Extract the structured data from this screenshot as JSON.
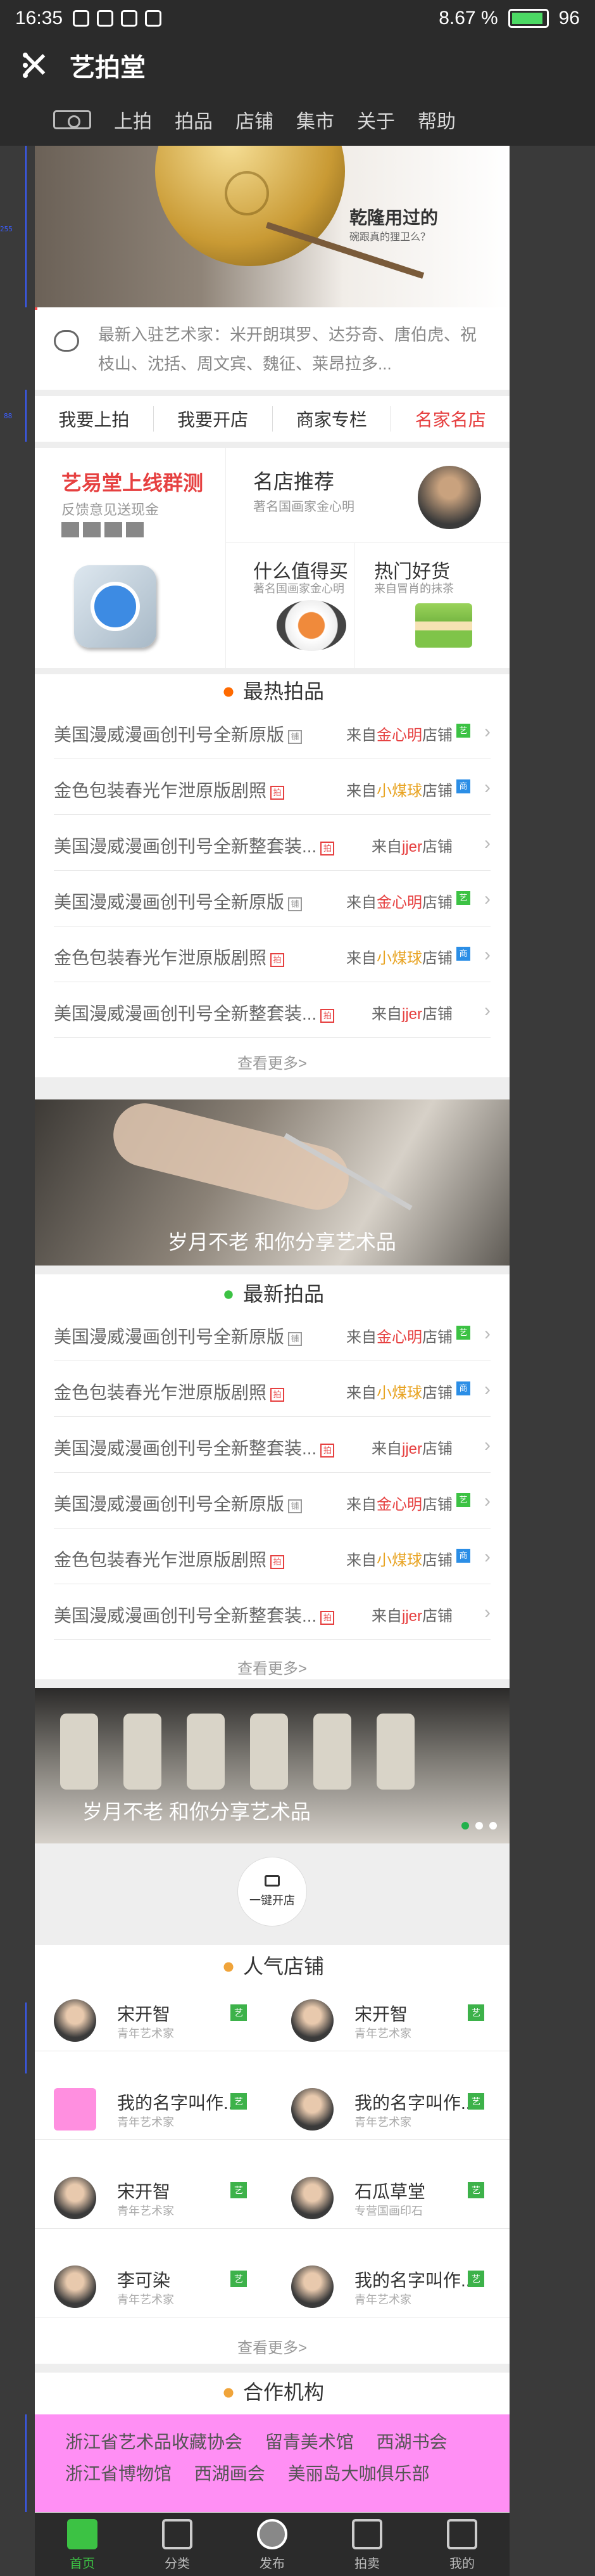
{
  "status_bar": {
    "time": "16:35",
    "battery_text": "8.67 %",
    "battery_level": "96"
  },
  "app_bar": {
    "close_glyph": "✕",
    "title": "艺拍堂"
  },
  "nav": {
    "items": [
      "上拍",
      "拍品",
      "店铺",
      "集市",
      "关于",
      "帮助"
    ]
  },
  "banner1": {
    "title": "乾隆用过的",
    "subtitle": "碗跟真的狸卫么？"
  },
  "notice": {
    "text": "最新入驻艺术家：米开朗琪罗、达芬奇、唐伯虎、祝枝山、沈括、周文宾、魏征、莱昂拉多..."
  },
  "quick_tabs": [
    "我要上拍",
    "我要开店",
    "商家专栏",
    "名家名店"
  ],
  "promo": {
    "left": {
      "title": "艺易堂上线群测",
      "subtitle": "反馈意见送现金"
    },
    "famous": {
      "title": "名店推荐",
      "subtitle": "著名国画家金心明"
    },
    "worth": {
      "title": "什么值得买",
      "subtitle": "著名国画家金心明"
    },
    "hot": {
      "title": "热门好货",
      "subtitle": "来自冒肖的抹茶"
    }
  },
  "hot_section": {
    "title": "最热拍品",
    "rows": [
      {
        "title": "美国漫威漫画创刊号全新原版",
        "tag": "铺",
        "shop_prefix": "来自",
        "shop_name": "金心明",
        "shop_suffix": "店铺",
        "badge": "艺"
      },
      {
        "title": "金色包装春光乍泄原版剧照",
        "tag": "拍",
        "shop_prefix": "来自",
        "shop_name": "小煤球",
        "shop_suffix": "店铺",
        "badge": "商"
      },
      {
        "title": "美国漫威漫画创刊号全新整套装...",
        "tag": "拍",
        "shop_prefix": "来自",
        "shop_name": "jjer",
        "shop_suffix": "店铺",
        "badge": ""
      },
      {
        "title": "美国漫威漫画创刊号全新原版",
        "tag": "铺",
        "shop_prefix": "来自",
        "shop_name": "金心明",
        "shop_suffix": "店铺",
        "badge": "艺"
      },
      {
        "title": "金色包装春光乍泄原版剧照",
        "tag": "拍",
        "shop_prefix": "来自",
        "shop_name": "小煤球",
        "shop_suffix": "店铺",
        "badge": "商"
      },
      {
        "title": "美国漫威漫画创刊号全新整套装...",
        "tag": "拍",
        "shop_prefix": "来自",
        "shop_name": "jjer",
        "shop_suffix": "店铺",
        "badge": ""
      }
    ],
    "more": "查看更多>"
  },
  "banner2": {
    "caption": "岁月不老 和你分享艺术品"
  },
  "new_section": {
    "title": "最新拍品",
    "rows": [
      {
        "title": "美国漫威漫画创刊号全新原版",
        "tag": "铺",
        "shop_prefix": "来自",
        "shop_name": "金心明",
        "shop_suffix": "店铺",
        "badge": "艺"
      },
      {
        "title": "金色包装春光乍泄原版剧照",
        "tag": "拍",
        "shop_prefix": "来自",
        "shop_name": "小煤球",
        "shop_suffix": "店铺",
        "badge": "商"
      },
      {
        "title": "美国漫威漫画创刊号全新整套装...",
        "tag": "拍",
        "shop_prefix": "来自",
        "shop_name": "jjer",
        "shop_suffix": "店铺",
        "badge": ""
      },
      {
        "title": "美国漫威漫画创刊号全新原版",
        "tag": "铺",
        "shop_prefix": "来自",
        "shop_name": "金心明",
        "shop_suffix": "店铺",
        "badge": "艺"
      },
      {
        "title": "金色包装春光乍泄原版剧照",
        "tag": "拍",
        "shop_prefix": "来自",
        "shop_name": "小煤球",
        "shop_suffix": "店铺",
        "badge": "商"
      },
      {
        "title": "美国漫威漫画创刊号全新整套装...",
        "tag": "拍",
        "shop_prefix": "来自",
        "shop_name": "jjer",
        "shop_suffix": "店铺",
        "badge": ""
      }
    ],
    "more": "查看更多>"
  },
  "banner3": {
    "caption": "岁月不老 和你分享艺术品"
  },
  "open_shop": {
    "label": "一键开店"
  },
  "popular_shops": {
    "title": "人气店铺",
    "shops": [
      {
        "name": "宋开智",
        "desc": "青年艺术家",
        "badge": "艺"
      },
      {
        "name": "宋开智",
        "desc": "青年艺术家",
        "badge": "艺"
      },
      {
        "name": "我的名字叫作...",
        "desc": "青年艺术家",
        "badge": "艺"
      },
      {
        "name": "我的名字叫作...",
        "desc": "青年艺术家",
        "badge": "艺"
      },
      {
        "name": "宋开智",
        "desc": "青年艺术家",
        "badge": "艺"
      },
      {
        "name": "石瓜草堂",
        "desc": "专营国画印石",
        "badge": "艺"
      },
      {
        "name": "李可染",
        "desc": "青年艺术家",
        "badge": "艺"
      },
      {
        "name": "我的名字叫作...",
        "desc": "青年艺术家",
        "badge": "艺"
      }
    ],
    "more": "查看更多>"
  },
  "partners": {
    "title": "合作机构",
    "row1": [
      "浙江省艺术品收藏协会",
      "留青美术馆",
      "西湖书会"
    ],
    "row2": [
      "浙江省博物馆",
      "西湖画会",
      "美丽岛大咖俱乐部"
    ]
  },
  "tabbar": {
    "items": [
      "首页",
      "分类",
      "发布",
      "拍卖",
      "我的"
    ]
  },
  "colors": {
    "accent_red": "#e64040",
    "green": "#3cc244",
    "dark": "#2b2b2b"
  }
}
